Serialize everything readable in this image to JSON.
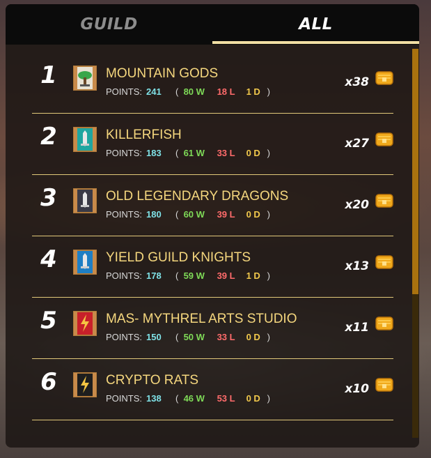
{
  "tabs": [
    {
      "label": "GUILD",
      "active": false
    },
    {
      "label": "ALL",
      "active": true
    }
  ],
  "labels": {
    "points": "POINTS:"
  },
  "scroll_position_fraction": 0.0,
  "guilds": [
    {
      "rank": "1",
      "name": "MOUNTAIN GODS",
      "points": "241",
      "wins": "80 W",
      "losses": "18 L",
      "draws": "1 D",
      "reward": "x38",
      "emblem": "tree-banner-icon"
    },
    {
      "rank": "2",
      "name": "KILLERFISH",
      "points": "183",
      "wins": "61 W",
      "losses": "33 L",
      "draws": "0 D",
      "reward": "x27",
      "emblem": "teal-banner-icon"
    },
    {
      "rank": "3",
      "name": "OLD LEGENDARY DRAGONS",
      "points": "180",
      "wins": "60 W",
      "losses": "39 L",
      "draws": "0 D",
      "reward": "x20",
      "emblem": "dark-banner-icon"
    },
    {
      "rank": "4",
      "name": "YIELD GUILD KNIGHTS",
      "points": "178",
      "wins": "59 W",
      "losses": "39 L",
      "draws": "1 D",
      "reward": "x13",
      "emblem": "blue-banner-icon"
    },
    {
      "rank": "5",
      "name": "MAS- MYTHREL ARTS STUDIO",
      "points": "150",
      "wins": "50 W",
      "losses": "33 L",
      "draws": "0 D",
      "reward": "x11",
      "emblem": "red-lightning-banner-icon"
    },
    {
      "rank": "6",
      "name": "CRYPTO RATS",
      "points": "138",
      "wins": "46 W",
      "losses": "53 L",
      "draws": "0 D",
      "reward": "x10",
      "emblem": "black-lightning-banner-icon"
    }
  ]
}
